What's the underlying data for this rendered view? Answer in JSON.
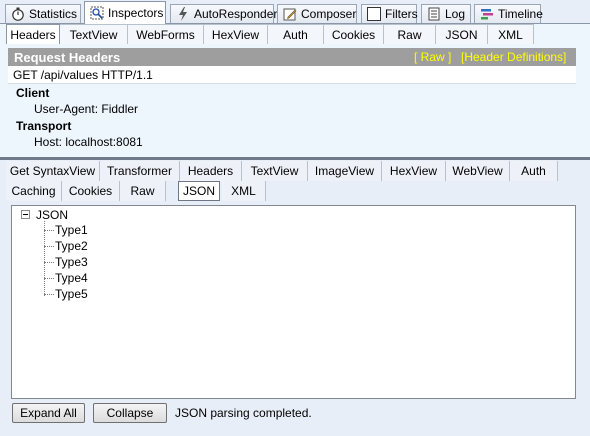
{
  "top_tabs": [
    {
      "label": "Statistics",
      "icon": "stopwatch-icon"
    },
    {
      "label": "Inspectors",
      "icon": "inspector-icon"
    },
    {
      "label": "AutoResponder",
      "icon": "lightning-icon"
    },
    {
      "label": "Composer",
      "icon": "composer-icon"
    },
    {
      "label": "Filters",
      "icon": "checkbox-icon"
    },
    {
      "label": "Log",
      "icon": "log-icon"
    },
    {
      "label": "Timeline",
      "icon": "timeline-icon"
    }
  ],
  "request": {
    "tabs": [
      "Headers",
      "TextView",
      "WebForms",
      "HexView",
      "Auth",
      "Cookies",
      "Raw",
      "JSON",
      "XML"
    ],
    "title": "Request Headers",
    "raw_link": "[ Raw ]",
    "defs_link": "[Header Definitions]",
    "request_line": "GET /api/values HTTP/1.1",
    "groups": [
      {
        "name": "Client",
        "items": [
          "User-Agent: Fiddler"
        ]
      },
      {
        "name": "Transport",
        "items": [
          "Host: localhost:8081"
        ]
      }
    ]
  },
  "response": {
    "tabs_row1": [
      "Get SyntaxView",
      "Transformer",
      "Headers",
      "TextView",
      "ImageView",
      "HexView",
      "WebView",
      "Auth"
    ],
    "tabs_row2": [
      "Caching",
      "Cookies",
      "Raw",
      "JSON",
      "XML"
    ],
    "tree": {
      "root": "JSON",
      "children": [
        "Type1",
        "Type2",
        "Type3",
        "Type4",
        "Type5"
      ]
    },
    "expand_all_label": "Expand All",
    "collapse_label": "Collapse",
    "status": "JSON parsing completed."
  },
  "colors": {
    "header_bar": "#9e9e9e",
    "header_link": "#ffff00",
    "panel_bg": "#eef6fd",
    "chrome_bg": "#e8eef7"
  }
}
